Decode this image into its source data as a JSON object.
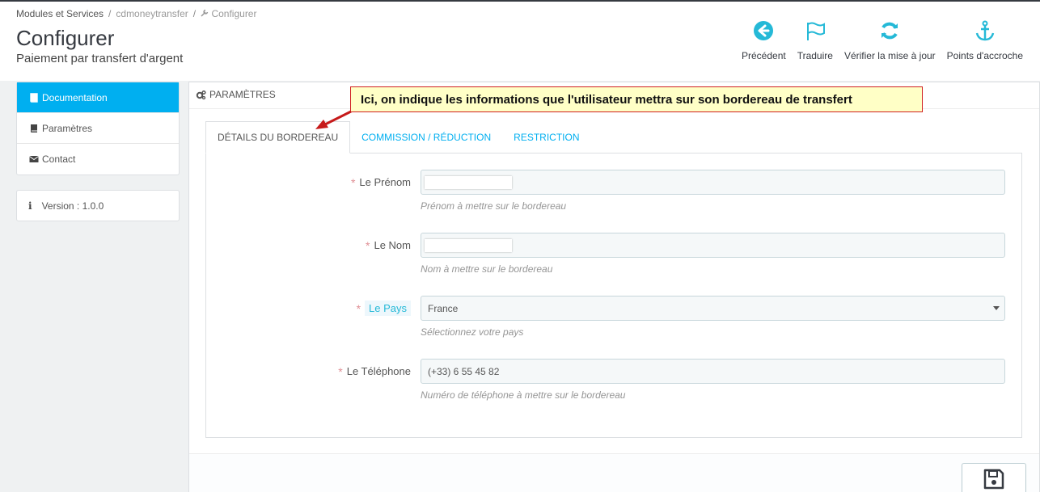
{
  "breadcrumb": {
    "item1": "Modules et Services",
    "sep": "/",
    "item2": "cdmoneytransfer",
    "item3": "Configurer"
  },
  "header": {
    "title": "Configurer",
    "subtitle": "Paiement par transfert d'argent"
  },
  "toolbar": {
    "back": "Précédent",
    "translate": "Traduire",
    "check_update": "Vérifier la mise à jour",
    "hooks": "Points d'accroche"
  },
  "sidebar": {
    "items": [
      {
        "label": "Documentation",
        "icon": "book-icon",
        "active": true
      },
      {
        "label": "Paramètres",
        "icon": "book-icon",
        "active": false
      },
      {
        "label": "Contact",
        "icon": "envelope-icon",
        "active": false
      }
    ],
    "version": "Version : 1.0.0"
  },
  "panel": {
    "heading": "PARAMÈTRES",
    "tabs": [
      {
        "label": "DÉTAILS DU BORDEREAU",
        "active": true
      },
      {
        "label": "COMMISSION / RÉDUCTION",
        "active": false
      },
      {
        "label": "RESTRICTION",
        "active": false
      }
    ]
  },
  "form": {
    "firstname": {
      "label": "Le Prénom",
      "value": "",
      "help": "Prénom à mettre sur le bordereau"
    },
    "lastname": {
      "label": "Le Nom",
      "value": "",
      "help": "Nom à mettre sur le bordereau"
    },
    "country": {
      "label": "Le Pays",
      "value": "France",
      "help": "Sélectionnez votre pays"
    },
    "phone": {
      "label": "Le Téléphone",
      "value": "(+33) 6 55 45 82",
      "help": "Numéro de téléphone à mettre sur le bordereau"
    },
    "required_mark": "*"
  },
  "annotation": {
    "text": "Ici, on indique les informations que l'utilisateur mettra sur son bordereau de transfert"
  },
  "colors": {
    "accent": "#00aff0",
    "required": "#e08f95",
    "callout_bg": "#ffffc6",
    "callout_border": "#d02020"
  }
}
